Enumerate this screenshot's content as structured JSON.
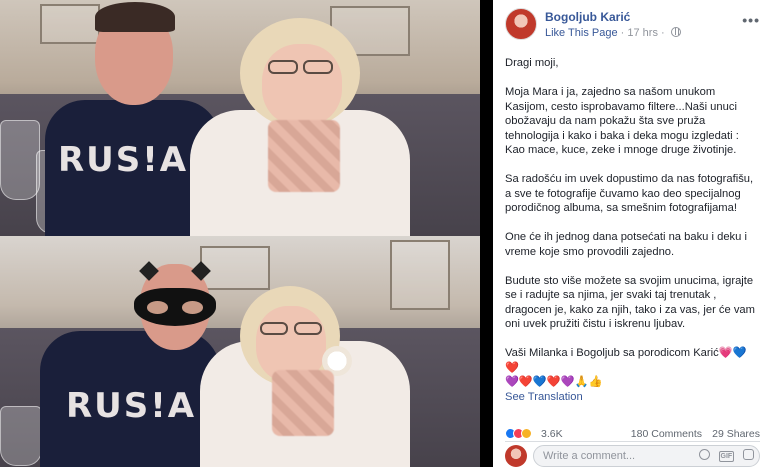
{
  "post": {
    "page_name": "Bogoljub Karić",
    "like_page": "Like This Page",
    "time": "17 hrs",
    "time_separator": "·",
    "paragraphs": [
      "Dragi moji,",
      "Moja Mara i ja, zajedno sa našom unukom Kasijom, cesto isprobavamo filtere...Naši unuci obožavaju da nam pokažu šta sve pruža tehnologija i kako i baka i deka mogu izgledati : Kao mace, kuce, zeke i mnoge druge životinje.",
      "Sa radošću im uvek dopustimo da nas fotografišu, a sve te fotografije čuvamo kao deo specijalnog porodičnog albuma, sa smešnim fotografijama!",
      "One će ih jednog dana potsećati na baku i deku i vreme koje smo provodili zajedno.",
      "Budute sto više možete sa svojim unucima, igrajte se i radujte sa njima, jer svaki taj trenutak , dragocen je, kako za njih, tako i za vas, jer će vam oni uvek pružiti čistu i iskrenu ljubav."
    ],
    "signature": "Vaši Milanka i Bogoljub sa porodicom Karić",
    "signature_emojis": "💗💙❤️",
    "emoji_line": "💜❤️💙❤️💜🙏👍",
    "see_translation": "See Translation"
  },
  "stats": {
    "reactions": "3.6K",
    "comments": "180 Comments",
    "shares": "29 Shares"
  },
  "comment_box": {
    "placeholder": "Write a comment..."
  },
  "icons": {
    "more": "more-options-icon",
    "globe": "globe-icon",
    "emoji": "emoji-icon",
    "gif": "GIF",
    "sticker": "sticker-icon"
  },
  "colors": {
    "link": "#385898",
    "meta": "#90949c",
    "like_blue": "#1877f2",
    "love_red": "#f33e58",
    "haha_yellow": "#f7b125"
  }
}
